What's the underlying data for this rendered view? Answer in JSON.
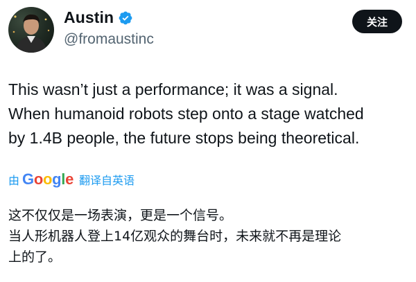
{
  "author": {
    "display_name": "Austin",
    "handle": "@fromaustinc",
    "verified_icon": "verified-badge-icon",
    "avatar_icon": "profile-photo"
  },
  "follow_button": {
    "label": "关注"
  },
  "tweet": {
    "lines": [
      "This wasn’t just a performance; it was a signal.",
      "When humanoid robots step onto a stage watched",
      "by 1.4B people, the future stops being theoretical."
    ]
  },
  "translation": {
    "prefix": "由",
    "provider_letters": [
      "G",
      "o",
      "o",
      "g",
      "l",
      "e"
    ],
    "provider_colors": [
      "#4285F4",
      "#EA4335",
      "#FBBC05",
      "#4285F4",
      "#34A853",
      "#EA4335"
    ],
    "source_label": "翻译自英语",
    "lines": [
      "这不仅仅是一场表演，更是一个信号。",
      "当人形机器人登上14亿观众的舞台时，未来就不再是理论",
      "上的了。"
    ]
  },
  "colors": {
    "text": "#0f1419",
    "secondary_text": "#536471",
    "link_blue": "#1d9bf0",
    "follow_button_bg": "#0f1419"
  }
}
